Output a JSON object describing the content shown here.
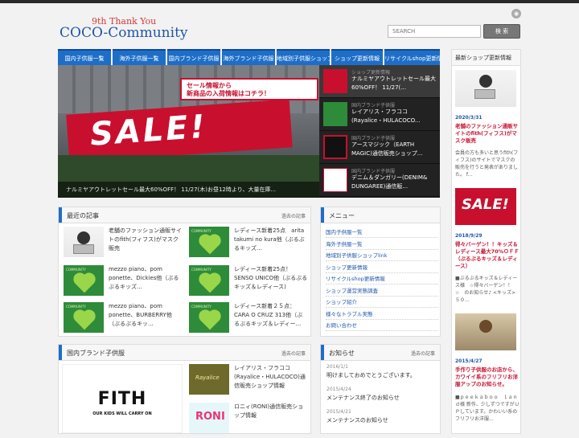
{
  "header": {
    "logo_sub": "9th Thank You",
    "logo_main": "COCO-Community",
    "search_placeholder": "SEARCH",
    "search_button": "検 索"
  },
  "nav": {
    "items": [
      {
        "label": "国内子供服一覧",
        "width": 66
      },
      {
        "label": "海外子供服一覧",
        "width": 66
      },
      {
        "label": "国内ブランド子供服",
        "width": 66
      },
      {
        "label": "海外ブランド子供服",
        "width": 66
      },
      {
        "label": "地域別子供服ショップ",
        "width": 66
      },
      {
        "label": "ショップ更新情報",
        "width": 64
      },
      {
        "label": "リサイクルshop更新情報",
        "width": 69
      }
    ]
  },
  "slider": {
    "main_promo_line1": "セール情報から",
    "main_promo_line2": "新商品の入荷情報はコチラ！",
    "sale_word": "SALE!",
    "caption": "ナルミヤアウトレットセール最大60%OFF！ 11/27(木)お昼12時より、大量在庫...",
    "items": [
      {
        "meta": "ショップ更新情報",
        "title": "ナルミヤアウトレットセール最大60%OFF！ 11/27(..."
      },
      {
        "meta": "国内ブランド子供服",
        "title": "レイアリス・フラココ (Rayalice・HULACOCO..."
      },
      {
        "meta": "国内ブランド子供服",
        "title": "アースマジック（EARTH MAGIC)通信販売ショップ..."
      },
      {
        "meta": "国内ブランド子供服",
        "title": "デニム＆ダンガリー(DENIM& DUNGAREE)通信販..."
      }
    ]
  },
  "recent": {
    "title": "最近の記事",
    "link": "過去の記事",
    "posts": [
      {
        "title": "老舗のファッション通販サイトのfith(フィフス)がマスク販売"
      },
      {
        "title": "レディース新着25点　arita takumi no kura他（ぶるぶるキッズ..."
      },
      {
        "title": "mezzo piano、pom ponette、Dickies他（ぶるぶるキッズ..."
      },
      {
        "title": "レディース新着25点！ SENSO UNICO他（ぶるぶるキッズ＆レディース)"
      },
      {
        "title": "mezzo piano、pom ponette、BURBERRY他（ぶるぶるキッ..."
      },
      {
        "title": "レディース新着２５点：CARA O CRUZ 313他（ぶるぶるキッズ＆レディー..."
      }
    ]
  },
  "brand": {
    "title": "国内ブランド子供服",
    "link": "過去の記事",
    "feature_logo": "FITH",
    "feature_tagline": "OUR KIDS WILL CARRY ON",
    "posts": [
      {
        "title": "レイアリス・フラココ(Rayalice・HULACOCO)通信販売ショップ情報",
        "thumb": "Rayalice"
      },
      {
        "title": "ロニィ(RONI)通信販売ショップ情報",
        "thumb": "RONI"
      }
    ]
  },
  "menu": {
    "title": "メニュー",
    "items": [
      "国内子供服一覧",
      "海外子供服一覧",
      "地域別子供服ショップlink",
      "ショップ更新情報",
      "リサイクルshop更新情報",
      "ショップ運営実態調査",
      "ショップ紹介",
      "様々なトラブル実態",
      "お問い合わせ"
    ]
  },
  "notice": {
    "title": "お知らせ",
    "link": "過去の記事",
    "items": [
      {
        "date": "2016/1/1",
        "title": "明けましておめでとうございます。"
      },
      {
        "date": "2015/4/24",
        "title": "メンテナンス終了のお知らせ"
      },
      {
        "date": "2015/4/21",
        "title": "メンテナンスのお知らせ"
      }
    ]
  },
  "sidebar": {
    "title": "最新ショップ更新情報",
    "entries": [
      {
        "date": "2020/3/31",
        "title": "老舗のファッション通販サイトのfith(フィフス)がマスク販売",
        "desc": "会員の方も多いと思うfith(フィフス)のサイトでマスクの販売を行うと発表がありました。 f..."
      },
      {
        "date": "2018/9/29",
        "title": "得々バーゲン！！キッズ＆レディース最大70%ＯＦＦ（ぶるぶるキッズ＆レディース）",
        "desc": "■ぶるぶるキッズ＆レディース様　☆得々バーゲン！！　☆　のお知らせ♪ <キッズ>５０..."
      },
      {
        "date": "2015/4/27",
        "title": "手作り子供服のお店から、カワイイ系のフリフリお洋服アップのお知らせ。",
        "desc": "■ｐｅｅｋａｂｏｏ　ｌａｎｄ様 新作、少しずつですがＵＰしています。かわいい系のフリフリお洋服..."
      }
    ]
  }
}
